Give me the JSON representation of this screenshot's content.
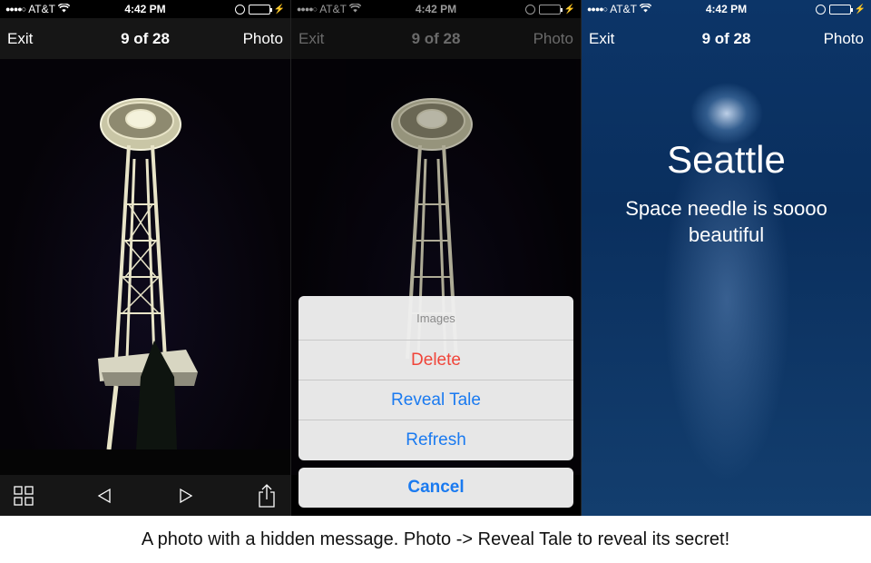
{
  "status_bar": {
    "carrier": "AT&T",
    "time": "4:42 PM"
  },
  "nav": {
    "left": "Exit",
    "title": "9 of 28",
    "right": "Photo"
  },
  "toolbar": {
    "icons": [
      "grid-icon",
      "previous-icon",
      "next-icon",
      "share-icon"
    ]
  },
  "action_sheet": {
    "title": "Images",
    "items": [
      "Delete",
      "Reveal Tale",
      "Refresh"
    ],
    "cancel": "Cancel",
    "destructive_color": "#f0453a",
    "action_color": "#1a7af0"
  },
  "reveal": {
    "title": "Seattle",
    "message": "Space needle is soooo beautiful",
    "background_color": "#0a2f5e"
  },
  "caption": "A photo with a hidden message. Photo -> Reveal Tale to reveal its secret!"
}
